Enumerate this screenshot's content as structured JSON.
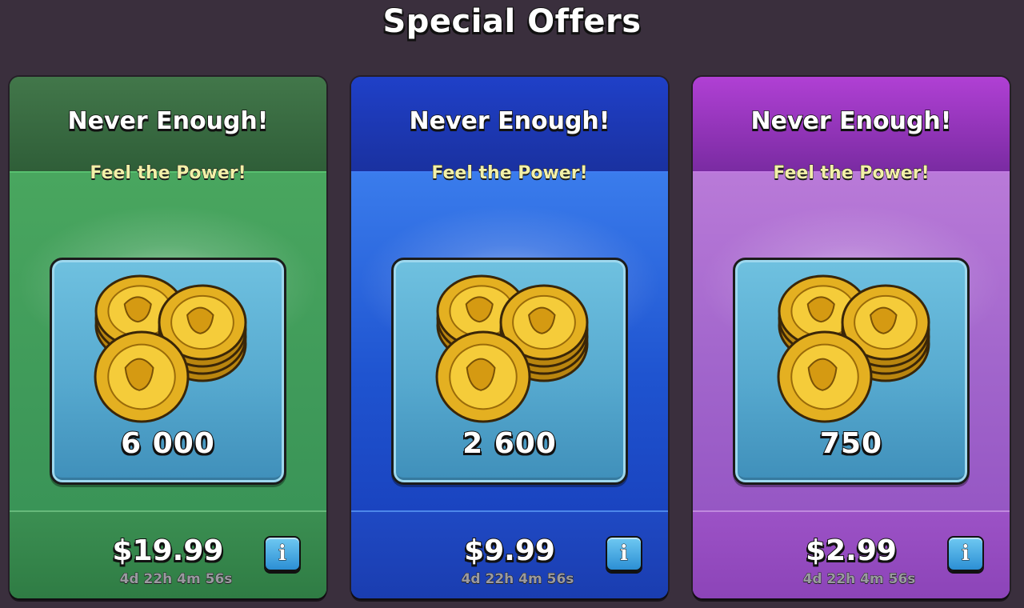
{
  "page": {
    "title": "Special Offers"
  },
  "offers": [
    {
      "theme": "green",
      "title": "Never Enough!",
      "subtitle": "Feel the Power!",
      "item_icon": "gold-coins-icon",
      "amount": "6 000",
      "price": "$19.99",
      "timer": "4d 22h 4m 56s",
      "info_icon": "info-icon",
      "info_label": "i"
    },
    {
      "theme": "blue",
      "title": "Never Enough!",
      "subtitle": "Feel the Power!",
      "item_icon": "gold-coins-icon",
      "amount": "2 600",
      "price": "$9.99",
      "timer": "4d 22h 4m 56s",
      "info_icon": "info-icon",
      "info_label": "i"
    },
    {
      "theme": "purple",
      "title": "Never Enough!",
      "subtitle": "Feel the Power!",
      "item_icon": "gold-coins-icon",
      "amount": "750",
      "price": "$2.99",
      "timer": "4d 22h 4m 56s",
      "info_icon": "info-icon",
      "info_label": "i"
    }
  ],
  "colors": {
    "background": "#3a2f3d",
    "green": "#34894c",
    "blue": "#1c49c4",
    "purple": "#9a48c4",
    "subtitle": "#f2f0a8",
    "coin_gold": "#e4b021",
    "tile": "#56a9cf"
  }
}
